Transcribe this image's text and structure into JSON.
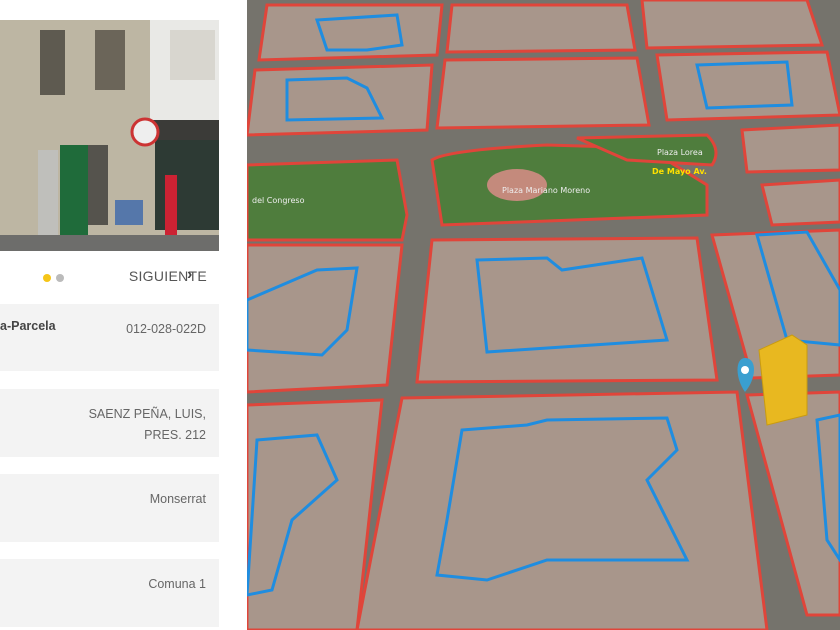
{
  "carousel": {
    "next_label": "SIGUIENTE",
    "active_color": "#f5c518",
    "inactive_color": "#bbbbbb"
  },
  "fields": [
    {
      "label": "a-Parcela",
      "value": "012-028-022D"
    },
    {
      "label": "",
      "value": "SAENZ PEÑA, LUIS,",
      "value2": "PRES. 212"
    },
    {
      "label": "",
      "value": "Monserrat"
    },
    {
      "label": "",
      "value": "Comuna 1"
    }
  ],
  "map": {
    "labels": [
      "Plaza Lorea",
      "De Mayo Av.",
      "Plaza Mariano Moreno",
      "del Congreso"
    ],
    "block_color": "#e0453a",
    "parcel_color": "#1f8de0",
    "building_color": "#f5c518",
    "pin_color": "#3a9fd0"
  }
}
